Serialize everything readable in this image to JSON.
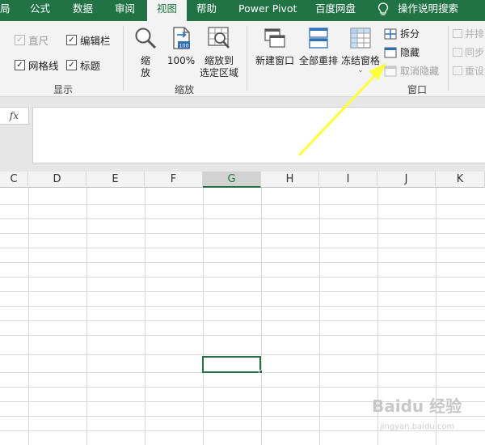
{
  "tabs": [
    {
      "label": "局",
      "active": false
    },
    {
      "label": "公式",
      "active": false
    },
    {
      "label": "数据",
      "active": false
    },
    {
      "label": "审阅",
      "active": false
    },
    {
      "label": "视图",
      "active": true
    },
    {
      "label": "帮助",
      "active": false
    },
    {
      "label": "Power Pivot",
      "active": false
    },
    {
      "label": "百度网盘",
      "active": false
    },
    {
      "label": "操作说明搜索",
      "active": false
    }
  ],
  "show_group": {
    "label": "显示",
    "ruler": {
      "label": "直尺",
      "checked": true,
      "enabled": false
    },
    "formula_bar": {
      "label": "编辑栏",
      "checked": true,
      "enabled": true
    },
    "gridlines": {
      "label": "网格线",
      "checked": true,
      "enabled": true
    },
    "headings": {
      "label": "标题",
      "checked": true,
      "enabled": true
    }
  },
  "zoom_group": {
    "label": "缩放",
    "zoom": "缩\n放",
    "zoom_100": "100%",
    "zoom_100_badge": "100",
    "zoom_selection": "缩放到\n选定区域"
  },
  "window_group": {
    "label": "窗口",
    "new_window": "新建窗口",
    "arrange_all": "全部重排",
    "freeze_panes": "冻结窗格",
    "split": "拆分",
    "hide": "隐藏",
    "unhide": "取消隐藏",
    "view_side_by_side": "并排",
    "sync_scroll": "同步",
    "reset_position": "重设"
  },
  "formula_bar": {
    "fx": "fx",
    "value": ""
  },
  "columns": [
    "C",
    "D",
    "E",
    "F",
    "G",
    "H",
    "I",
    "J",
    "K"
  ],
  "selected_column": "G",
  "watermark": {
    "brand": "Baidu 经验",
    "url": "jingyan.baidu.com"
  },
  "colors": {
    "accent": "#217346",
    "arrow": "#ffff3a"
  }
}
